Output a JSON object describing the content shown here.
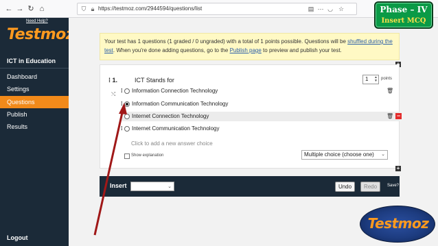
{
  "browser": {
    "url": "https://testmoz.com/2944594/questions/list"
  },
  "sidebar": {
    "need_help": "Need Help?",
    "logo": "Testmoz",
    "section_title": "ICT in Education",
    "items": [
      {
        "label": "Dashboard",
        "active": false
      },
      {
        "label": "Settings",
        "active": false
      },
      {
        "label": "Questions",
        "active": true
      },
      {
        "label": "Publish",
        "active": false
      },
      {
        "label": "Results",
        "active": false
      }
    ],
    "logout": "Logout"
  },
  "notice": {
    "part1": "Your test has 1 questions (1 graded / 0 ungraded) with a total of 1 points possible. Questions will be ",
    "link1": "shuffled during the test",
    "part2": ". When you're done adding questions, go to the ",
    "link2": "Publish page",
    "part3": " to preview and publish your test."
  },
  "question": {
    "number": "1.",
    "text": "ICT Stands for",
    "points_value": "1",
    "points_label": "points",
    "answers": [
      {
        "text": "Information Connection Technology",
        "selected": false
      },
      {
        "text": "Information Communication Technology",
        "selected": true
      },
      {
        "text": "Internet Connection Technology",
        "selected": false
      },
      {
        "text": "Internet Communication Technology",
        "selected": false
      }
    ],
    "add_choice": "Click to add a new answer choice",
    "show_explanation": "Show explanation",
    "question_type": "Multiple choice (choose one)"
  },
  "insert_bar": {
    "label": "Insert",
    "undo": "Undo",
    "redo": "Redo",
    "save": "Save?"
  },
  "overlay": {
    "phase_title": "Phase – IV",
    "phase_subtitle": "Insert MCQ",
    "watermark": "Testmoz"
  },
  "colors": {
    "sidebar_bg": "#1b2a38",
    "accent_orange": "#f28a1a",
    "notice_bg": "#fff9c4",
    "arrow_red": "#a01818",
    "phase_green": "#0a9a46"
  }
}
